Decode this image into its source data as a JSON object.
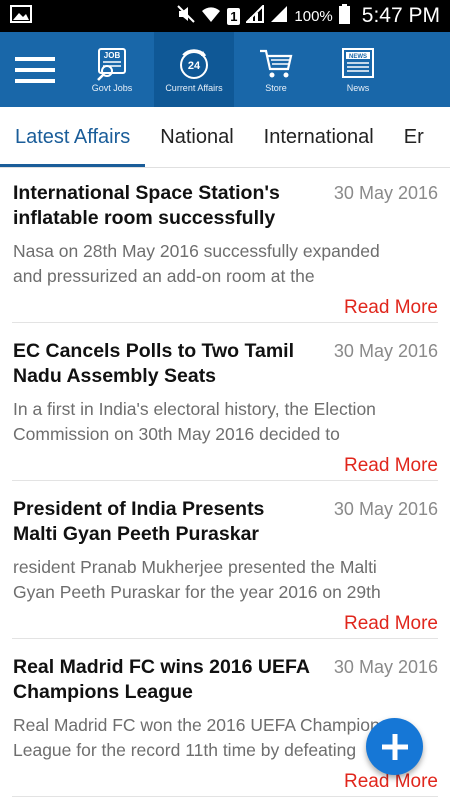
{
  "status_bar": {
    "battery_percent": "100%",
    "time": "5:47 PM",
    "sim_badge": "1"
  },
  "top_nav": {
    "items": [
      {
        "label": "Govt Jobs",
        "icon": "govt-jobs-icon",
        "badge": "JOB"
      },
      {
        "label": "Current Affairs",
        "icon": "current-affairs-icon",
        "badge": "24"
      },
      {
        "label": "Store",
        "icon": "cart-icon"
      },
      {
        "label": "News",
        "icon": "newspaper-icon",
        "badge": "NEWS"
      }
    ],
    "active_index": 1
  },
  "tabs": [
    {
      "label": "Latest Affairs",
      "active": true
    },
    {
      "label": "National",
      "active": false
    },
    {
      "label": "International",
      "active": false
    },
    {
      "label": "Er",
      "active": false
    }
  ],
  "articles": [
    {
      "title": "International Space Station's inflatable room successfully",
      "date": "30 May 2016",
      "excerpt_line1": "Nasa on 28th May 2016 successfully expanded",
      "excerpt_line2": "and pressurized an add-on room at the",
      "read_more": "Read More"
    },
    {
      "title": "EC Cancels Polls to Two Tamil Nadu Assembly Seats",
      "date": "30 May 2016",
      "excerpt_line1": "In a first in India's electoral history, the Election",
      "excerpt_line2": "Commission on 30th May 2016 decided to",
      "read_more": "Read More"
    },
    {
      "title": "President of India Presents Malti Gyan Peeth Puraskar",
      "date": "30 May 2016",
      "excerpt_line1": "resident Pranab Mukherjee presented the Malti",
      "excerpt_line2": "Gyan Peeth Puraskar for the year 2016 on 29th",
      "read_more": "Read More"
    },
    {
      "title": "Real Madrid FC wins 2016 UEFA Champions League",
      "date": "30 May 2016",
      "excerpt_line1": "Real Madrid FC won the 2016 UEFA Champions",
      "excerpt_line2": "League for the record 11th time by defeating",
      "read_more": "Read More"
    }
  ],
  "fab": {
    "icon": "plus-icon"
  },
  "colors": {
    "primary": "#1967a9",
    "accent_red": "#e0261c",
    "tab_active": "#1a5d99",
    "fab": "#1677d6"
  }
}
